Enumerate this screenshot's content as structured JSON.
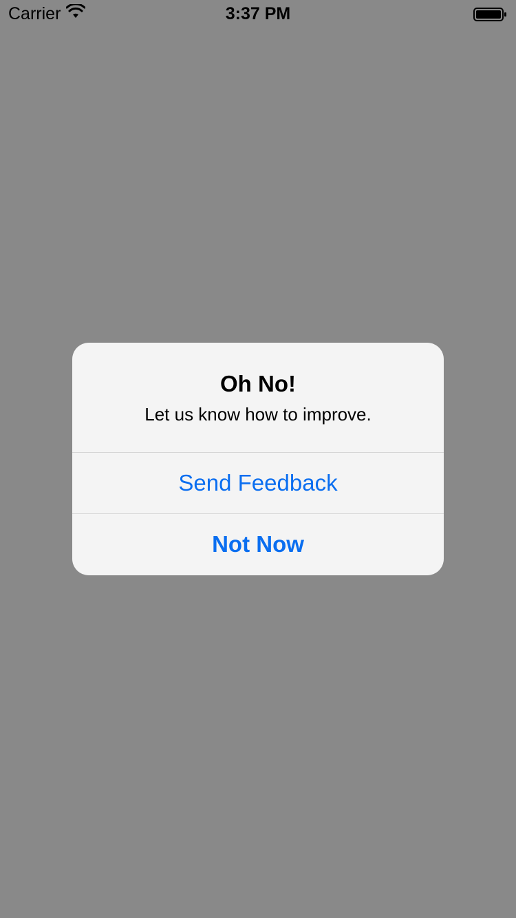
{
  "status_bar": {
    "carrier": "Carrier",
    "time": "3:37 PM",
    "wifi_icon": "wifi-icon",
    "battery_icon": "battery-icon"
  },
  "alert": {
    "title": "Oh No!",
    "message": "Let us know how to improve.",
    "buttons": [
      {
        "label": "Send Feedback",
        "style": "default"
      },
      {
        "label": "Not Now",
        "style": "preferred"
      }
    ]
  },
  "colors": {
    "background_dim": "#898989",
    "alert_background": "#f4f4f4",
    "button_text": "#0a6ef0"
  }
}
